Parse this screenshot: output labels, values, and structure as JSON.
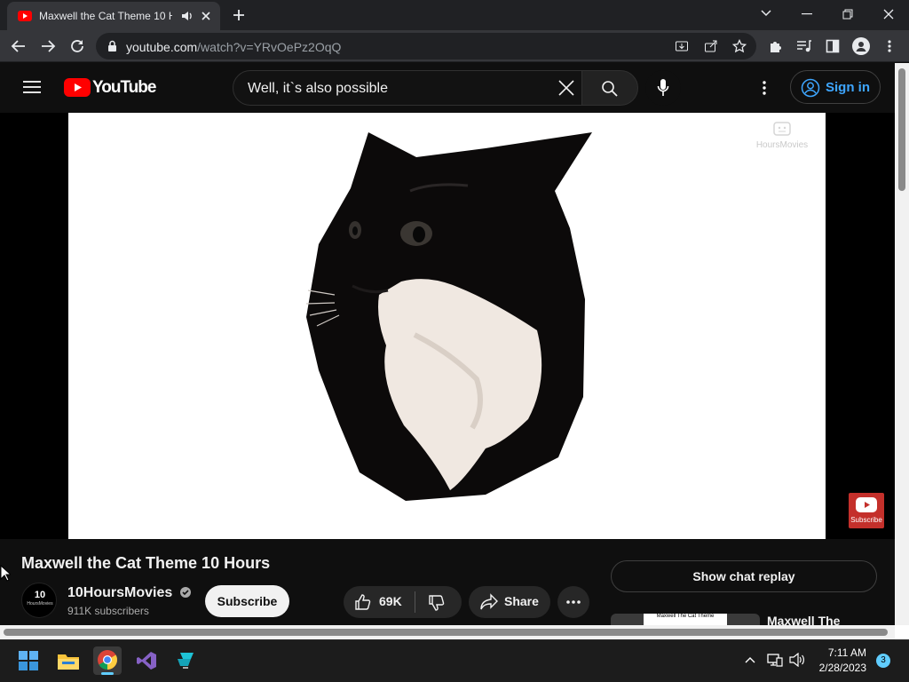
{
  "browser": {
    "tab_title": "Maxwell the Cat Theme 10 H",
    "url_host": "youtube.com",
    "url_path": "/watch?v=YRvOePz2OqQ"
  },
  "youtube": {
    "logo_text": "YouTube",
    "search_query": "Well, it`s also possible",
    "sign_in_label": "Sign in",
    "video_title": "Maxwell the Cat Theme 10 Hours",
    "channel_name": "10HoursMovies",
    "channel_avatar_top": "10",
    "channel_avatar_bottom": "HoursMovies",
    "subscribers": "911K subscribers",
    "subscribe_label": "Subscribe",
    "like_count": "69K",
    "share_label": "Share",
    "chat_replay_label": "Show chat replay",
    "watermark_text": "HoursMovies",
    "subscribe_watermark_label": "Subscribe",
    "rec_thumb_text": "Maxwell The Cat Theme",
    "rec_title": "Maxwell The"
  },
  "taskbar": {
    "time": "7:11 AM",
    "date": "2/28/2023",
    "notification_count": "3"
  },
  "icons": [
    "youtube-favicon",
    "speaker-icon",
    "close-icon",
    "new-tab-icon",
    "chevron-down-icon",
    "minimize-icon",
    "restore-icon",
    "window-close-icon",
    "back-icon",
    "forward-icon",
    "reload-icon",
    "lock-icon",
    "install-icon",
    "share-icon",
    "star-icon",
    "extensions-icon",
    "media-icon",
    "sidepanel-icon",
    "profile-icon",
    "menu-dots-icon",
    "hamburger-icon",
    "youtube-logo",
    "clear-icon",
    "search-icon",
    "mic-icon",
    "more-icon",
    "account-icon",
    "verified-icon",
    "thumbs-up-icon",
    "thumbs-down-icon",
    "share-arrow-icon",
    "windows-start-icon",
    "file-explorer-icon",
    "chrome-icon",
    "visual-studio-icon",
    "app-icon",
    "chevron-up-icon",
    "network-icon",
    "volume-icon"
  ],
  "colors": {
    "youtube_red": "#ff0000",
    "link_blue": "#3ea6ff",
    "accent_blue": "#60cdff"
  }
}
